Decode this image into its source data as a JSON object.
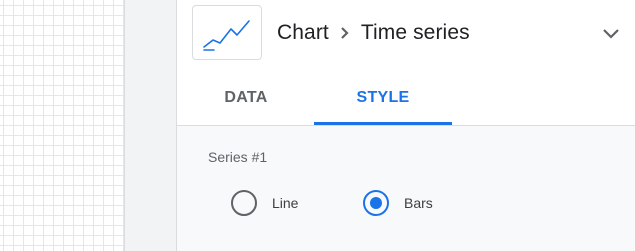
{
  "header": {
    "chart_icon": "timeseries-chart-icon",
    "breadcrumb_root": "Chart",
    "separator": "chevron-right-icon",
    "breadcrumb_current": "Time series",
    "expand_icon": "chevron-down-icon"
  },
  "tabs": [
    {
      "label": "DATA",
      "active": false
    },
    {
      "label": "STYLE",
      "active": true
    }
  ],
  "style": {
    "series_label": "Series #1",
    "options": [
      {
        "label": "Line",
        "selected": false
      },
      {
        "label": "Bars",
        "selected": true
      }
    ]
  },
  "colors": {
    "accent": "#1a73e8",
    "text_primary": "#202124",
    "text_secondary": "#5f6368",
    "divider": "#dadce0"
  }
}
